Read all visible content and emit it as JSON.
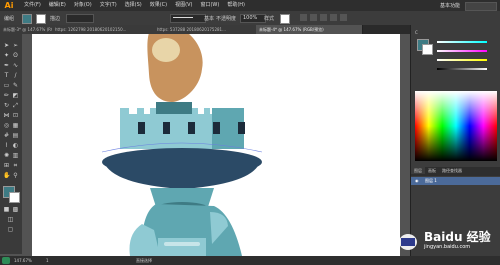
{
  "app": {
    "logo_text": "Ai"
  },
  "menu": [
    "文件(F)",
    "编辑(E)",
    "对象(O)",
    "文字(T)",
    "选择(S)",
    "效果(C)",
    "视图(V)",
    "窗口(W)",
    "帮助(H)"
  ],
  "workspace": {
    "label": "基本功能"
  },
  "control_bar": {
    "selection_label": "编组",
    "stroke_label": "描边",
    "stroke_style": "基本",
    "opacity_label": "不透明度",
    "opacity_value": "100%",
    "style_label": "样式"
  },
  "tabs": [
    {
      "label": "未标题-3* @ 147.67% (RGB/...",
      "active": false
    },
    {
      "label": "https: 1262798 20180620102150... ",
      "active": false
    },
    {
      "label": "https: 537288 20180620175281... ",
      "active": false
    },
    {
      "label": "未标题-4* @ 147.67% (RGB/预览)",
      "active": true
    }
  ],
  "status_bar": {
    "zoom": "147.67%",
    "mode": "直接选择",
    "page": "1"
  },
  "right_panel": {
    "color_label": "C",
    "layers_tabs": [
      "图层",
      "画板",
      "路径查找器"
    ],
    "layer_name": "图层 1"
  },
  "watermark": {
    "text": "Baidu 经验",
    "sub": "jingyan.baidu.com"
  },
  "colors": {
    "flame": "#c8935e",
    "flame_highlight": "#e8d5a8",
    "teal_dark": "#3e7b84",
    "teal_mid": "#5fa7b1",
    "teal_light": "#8fcad3",
    "navy": "#2b4a66"
  }
}
